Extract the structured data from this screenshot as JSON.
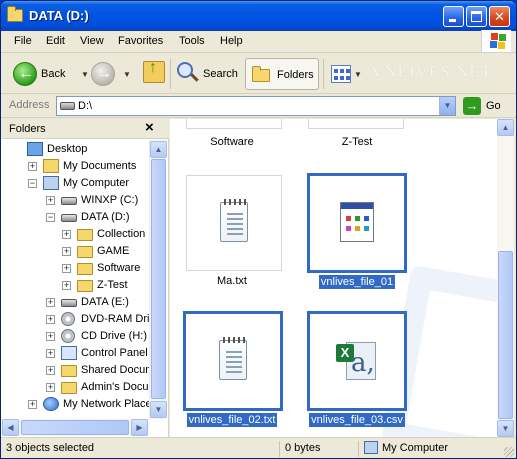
{
  "window": {
    "title": "DATA (D:)"
  },
  "menu": [
    {
      "label": "File",
      "accel": "F"
    },
    {
      "label": "Edit",
      "accel": "E"
    },
    {
      "label": "View",
      "accel": "V"
    },
    {
      "label": "Favorites",
      "accel": "a"
    },
    {
      "label": "Tools",
      "accel": "T"
    },
    {
      "label": "Help",
      "accel": "H"
    }
  ],
  "watermark": "VNLIVES.NET",
  "toolbar": {
    "back_label": "Back",
    "search_label": "Search",
    "folders_label": "Folders"
  },
  "address": {
    "label": "Address",
    "value": "D:\\",
    "go_label": "Go"
  },
  "folders_pane": {
    "title": "Folders",
    "close": "×",
    "tree": [
      {
        "label": "Desktop",
        "icon": "desktop-icon",
        "expander": ""
      },
      {
        "label": "My Documents",
        "icon": "my-documents-icon",
        "expander": "+"
      },
      {
        "label": "My Computer",
        "icon": "my-computer-icon",
        "expander": "−"
      },
      {
        "label": "WINXP (C:)",
        "icon": "drive-icon",
        "expander": "+"
      },
      {
        "label": "DATA (D:)",
        "icon": "drive-icon",
        "expander": "−"
      },
      {
        "label": "Collection",
        "icon": "folder-icon",
        "expander": "+"
      },
      {
        "label": "GAME",
        "icon": "folder-icon",
        "expander": "+"
      },
      {
        "label": "Software",
        "icon": "folder-icon",
        "expander": "+"
      },
      {
        "label": "Z-Test",
        "icon": "folder-icon",
        "expander": "+"
      },
      {
        "label": "DATA (E:)",
        "icon": "drive-icon",
        "expander": "+"
      },
      {
        "label": "DVD-RAM Drive (F",
        "icon": "cd-drive-icon",
        "expander": "+"
      },
      {
        "label": "CD Drive (H:)",
        "icon": "cd-drive-icon",
        "expander": "+"
      },
      {
        "label": "Control Panel",
        "icon": "control-panel-icon",
        "expander": "+"
      },
      {
        "label": "Shared Document",
        "icon": "folder-icon",
        "expander": "+"
      },
      {
        "label": "Admin's Documen",
        "icon": "folder-icon",
        "expander": "+"
      },
      {
        "label": "My Network Places",
        "icon": "network-icon",
        "expander": "+"
      }
    ]
  },
  "files": [
    {
      "name": "Software",
      "type": "folder",
      "selected": false
    },
    {
      "name": "Z-Test",
      "type": "folder",
      "selected": false
    },
    {
      "name": "Ma.txt",
      "type": "text",
      "selected": false
    },
    {
      "name": "vnlives_file_01",
      "type": "application",
      "selected": true
    },
    {
      "name": "vnlives_file_02.txt",
      "type": "text",
      "selected": true
    },
    {
      "name": "vnlives_file_03.csv",
      "type": "excel-csv",
      "selected": true
    }
  ],
  "status": {
    "selection": "3 objects selected",
    "size": "0 bytes",
    "location": "My Computer"
  },
  "colors": {
    "titlebar": "#0054e3",
    "selection": "#316ac5",
    "chrome": "#ece9d8"
  }
}
